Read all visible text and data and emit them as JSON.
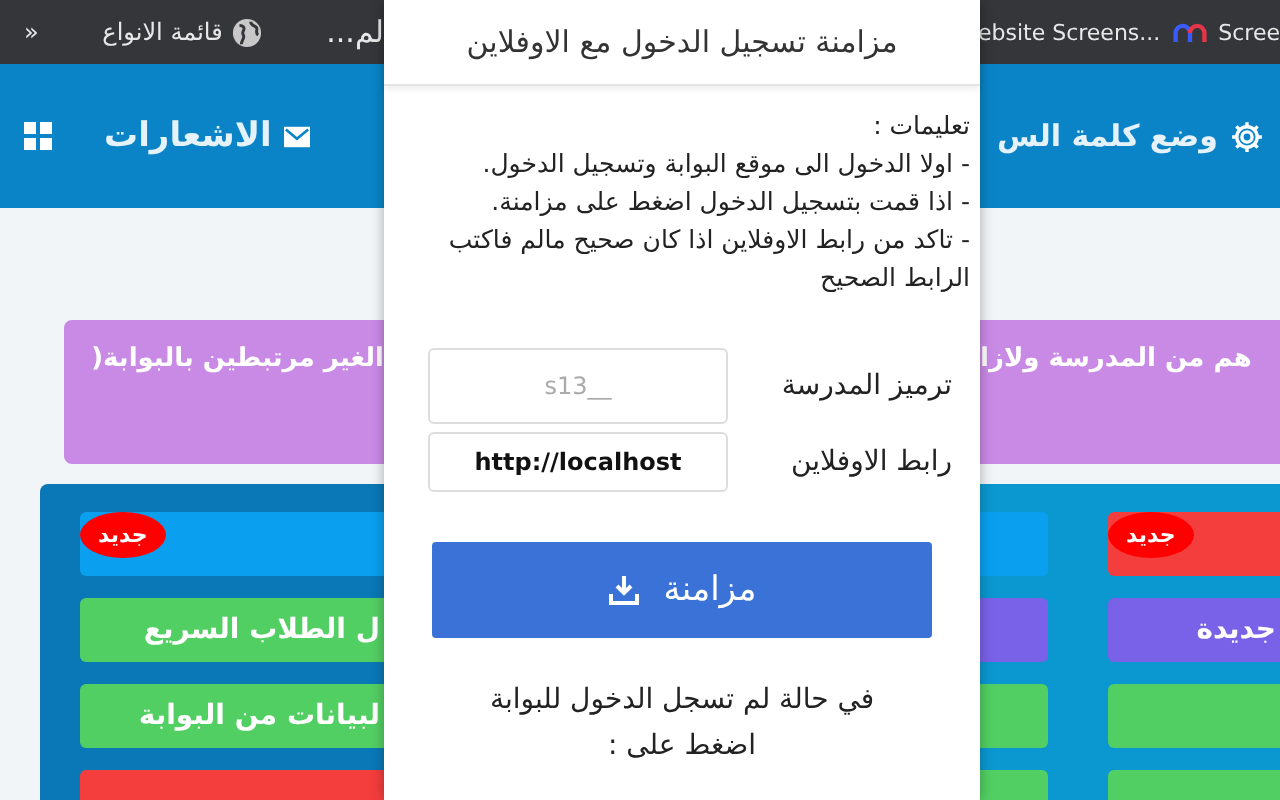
{
  "bookmarks_bar": {
    "items": [
      {
        "label": "Scree"
      },
      {
        "label": "ebsite Screens..."
      },
      {
        "label": "لم..."
      },
      {
        "label": "قائمة الانواع"
      },
      {
        "label": "»"
      }
    ]
  },
  "nav": {
    "items": [
      {
        "label": "وضع كلمة الس"
      },
      {
        "label": "الاشعارات"
      }
    ]
  },
  "page": {
    "notice_left": "الغير مرتبطين بالبوابة(",
    "notice_right": "هم من المدرسة ولازا",
    "left_panel": {
      "buttons": [
        {
          "kind": "blue",
          "badge": "جديد"
        },
        {
          "kind": "green",
          "label": "ل الطلاب السريع"
        },
        {
          "kind": "green",
          "label": "لبيانات من البوابة"
        },
        {
          "kind": "red"
        }
      ]
    },
    "right_panel": {
      "rows": [
        [
          {
            "kind": "blue"
          },
          {
            "kind": "red",
            "badge": "جديد"
          }
        ],
        [
          {
            "kind": "purple"
          },
          {
            "kind": "purple",
            "label": "جديدة"
          }
        ],
        [
          {
            "kind": "green"
          },
          {
            "kind": "green"
          }
        ],
        [
          {
            "kind": "green"
          },
          {
            "kind": "green"
          }
        ]
      ]
    }
  },
  "popup": {
    "title": "مزامنة تسجيل الدخول مع الاوفلاين",
    "instructions_heading": "تعليمات :",
    "instructions": [
      "- اولا الدخول الى موقع البوابة وتسجيل الدخول.",
      "- اذا قمت بتسجيل الدخول اضغط على مزامنة.",
      "- تاكد من رابط الاوفلاين اذا كان صحيح مالم فاكتب الرابط الصحيح"
    ],
    "fields": [
      {
        "label": "ترميز المدرسة",
        "placeholder": "s13__"
      },
      {
        "label": "رابط الاوفلاين",
        "value": "http://localhost"
      }
    ],
    "sync_button": "مزامنة",
    "footer": [
      "في حالة لم تسجل الدخول للبوابة",
      "اضغط على :"
    ]
  }
}
